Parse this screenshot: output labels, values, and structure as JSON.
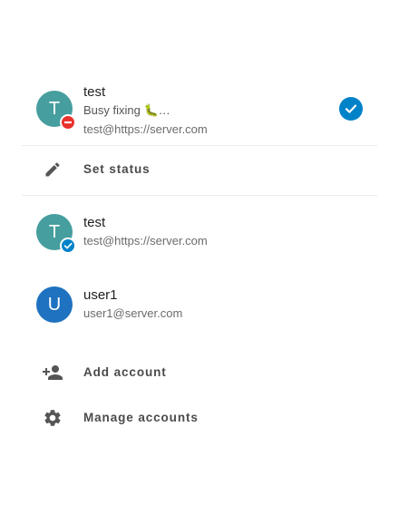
{
  "colors": {
    "accent": "#0082c9",
    "avatar_teal": "#469e9e",
    "avatar_blue": "#1e72c0",
    "dnd_red": "#e9322d",
    "icon_gray": "#555555"
  },
  "current_account": {
    "avatar_letter": "T",
    "display_name": "test",
    "status_emoji": "🐛",
    "status_message": "Busy fixing",
    "status_ellipsis": "…",
    "account_id": "test@https://server.com",
    "status_icon": "do-not-disturb-icon",
    "selected_icon": "checkmark-circle-icon"
  },
  "set_status": {
    "icon": "pencil-icon",
    "label": "Set status"
  },
  "accounts": [
    {
      "avatar_letter": "T",
      "display_name": "test",
      "account_id": "test@https://server.com",
      "status_icon": "online-check-icon"
    },
    {
      "avatar_letter": "U",
      "display_name": "user1",
      "account_id": "user1@server.com"
    }
  ],
  "actions": {
    "add_account": {
      "icon": "person-add-icon",
      "label": "Add account"
    },
    "manage_accounts": {
      "icon": "gear-icon",
      "label": "Manage accounts"
    }
  }
}
